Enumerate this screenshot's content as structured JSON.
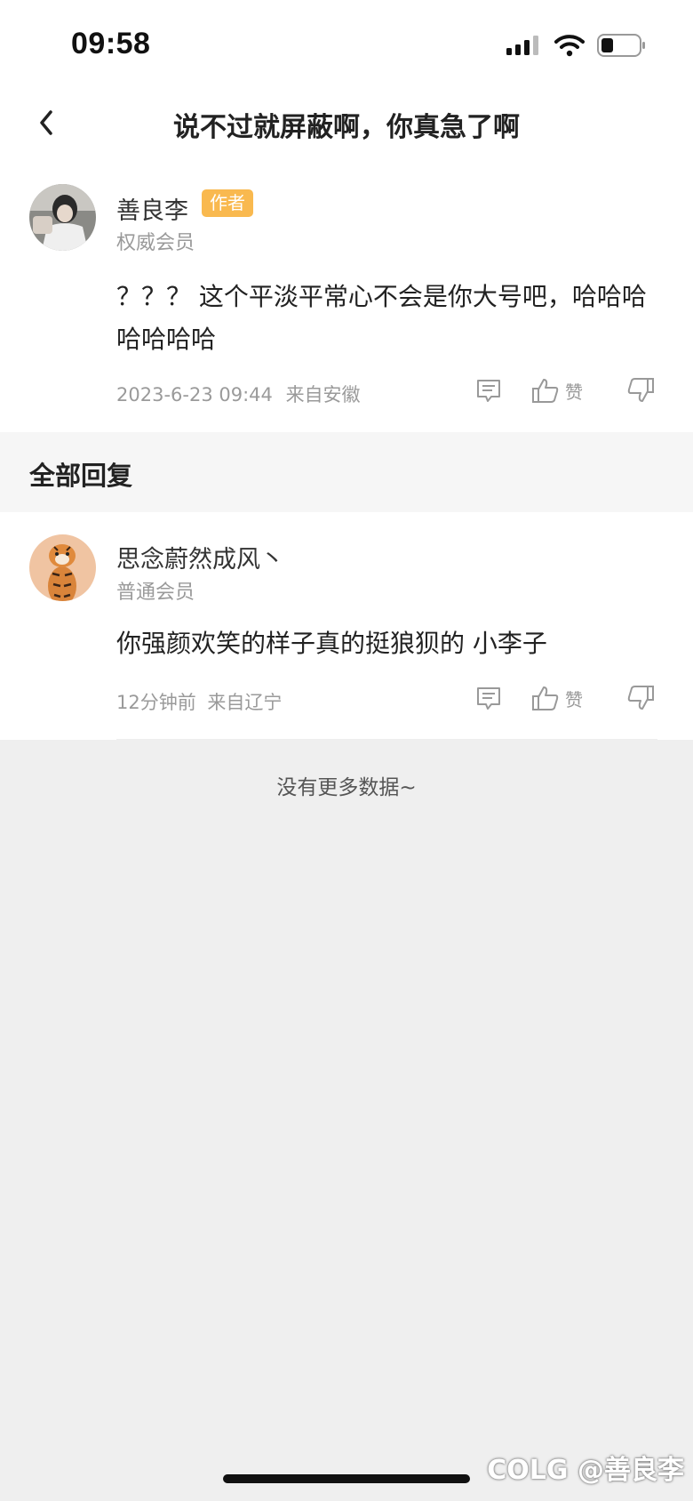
{
  "status_bar": {
    "time": "09:58"
  },
  "nav": {
    "title": "说不过就屏蔽啊，你真急了啊"
  },
  "main_post": {
    "author": "善良李",
    "badge": "作者",
    "member_level": "权威会员",
    "content": "？？？ 这个平淡平常心不会是你大号吧，哈哈哈哈哈哈哈",
    "timestamp": "2023-6-23 09:44",
    "location": "来自安徽",
    "like_label": "赞"
  },
  "section": {
    "title": "全部回复"
  },
  "replies": [
    {
      "author": "思念蔚然成风丶",
      "member_level": "普通会员",
      "content": "你强颜欢笑的样子真的挺狼狈的  小李子",
      "timestamp": "12分钟前",
      "location": "来自辽宁",
      "like_label": "赞"
    }
  ],
  "footer": {
    "no_more": "没有更多数据~"
  },
  "watermark": "COLG @善良李"
}
